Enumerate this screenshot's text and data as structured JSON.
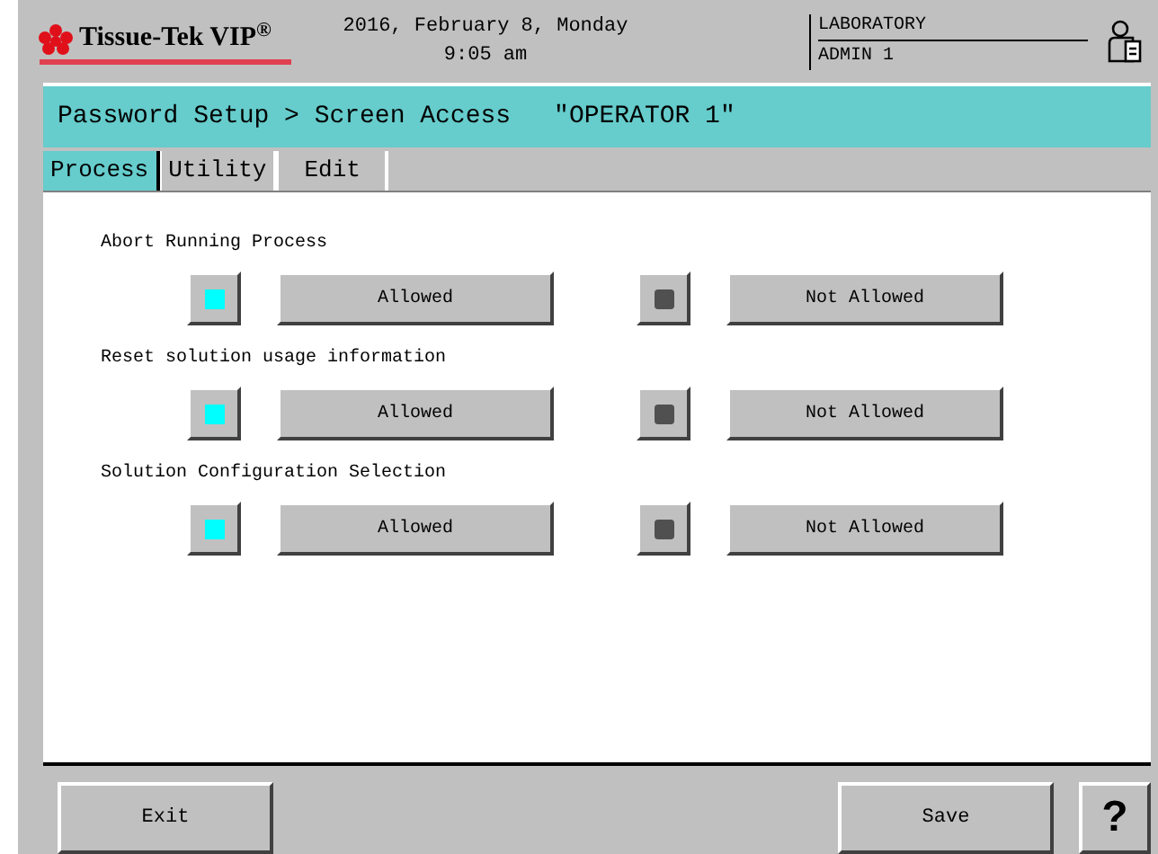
{
  "header": {
    "logo": "Tissue-Tek  VIP$^{®}$",
    "date": "2016, February 8, Monday",
    "time": "9:05 am",
    "location": "LABORATORY",
    "user": "ADMIN 1"
  },
  "breadcrumb": {
    "path": "Password Setup > Screen Access",
    "operator": "\"OPERATOR 1\""
  },
  "tabs": [
    {
      "label": "Process",
      "selected": true
    },
    {
      "label": "Utility",
      "selected": false
    },
    {
      "label": "Edit",
      "selected": false
    }
  ],
  "settings": [
    {
      "label": "Abort Running Process",
      "options": [
        {
          "label": "Allowed",
          "selected": true
        },
        {
          "label": "Not Allowed",
          "selected": false
        }
      ]
    },
    {
      "label": "Reset solution usage information",
      "options": [
        {
          "label": "Allowed",
          "selected": true
        },
        {
          "label": "Not Allowed",
          "selected": false
        }
      ]
    },
    {
      "label": "Solution Configuration Selection",
      "options": [
        {
          "label": "Allowed",
          "selected": true
        },
        {
          "label": "Not Allowed",
          "selected": false
        }
      ]
    }
  ],
  "footer": {
    "exit": "Exit",
    "save": "Save",
    "help": "?"
  }
}
